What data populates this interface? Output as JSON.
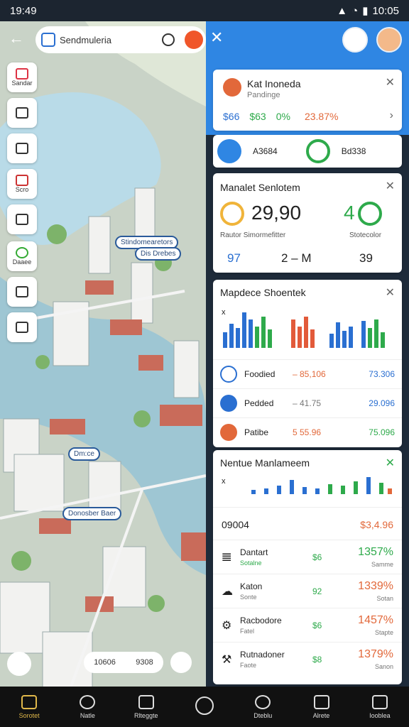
{
  "status": {
    "time": "19:49",
    "clock": "10:05"
  },
  "search": {
    "text": "Sendmuleria"
  },
  "sidebar": [
    {
      "label": "Sandar"
    },
    {
      "label": ""
    },
    {
      "label": ""
    },
    {
      "label": "Scro"
    },
    {
      "label": ""
    },
    {
      "label": "Daaee"
    },
    {
      "label": ""
    },
    {
      "label": ""
    }
  ],
  "map_labels": {
    "a": "Stindomearetors",
    "b": "Dis Drebes",
    "c": "Donosber Baer",
    "d": "Dm:ce"
  },
  "map_bottom": {
    "left": "10606",
    "right": "9308"
  },
  "panel1": {
    "title": "Kat Inoneda",
    "subtitle": "Pandinge",
    "v1": "$66",
    "v2": "$63",
    "v3": "0%",
    "v4": "23.87%",
    "row_left": "A3684",
    "row_right": "Bd338"
  },
  "panel2": {
    "title": "Manalet Senlotem",
    "big": "29,90",
    "big_right": "4",
    "caption_left": "Rautor Simormefitter",
    "caption_right": "Stotecolor",
    "n1": "97",
    "n2": "2 – M",
    "n3": "39"
  },
  "panel3": {
    "title": "Mapdece Shoentek",
    "axis": "x",
    "rows": [
      {
        "name": "Foodied",
        "v1": "– 85,106",
        "v2": "73.306"
      },
      {
        "name": "Pedded",
        "v1": "– 41.75",
        "v2": "29.096"
      },
      {
        "name": "Patibe",
        "v1": "5 55.96",
        "v2": "75.096"
      }
    ]
  },
  "panel4": {
    "title": "Nentue Manlameem",
    "axis": "x",
    "head_left": "09004",
    "head_right": "$3,4.96",
    "rows": [
      {
        "name": "Dantart",
        "sub": "Sotalne",
        "mid": "$6",
        "pct": "1357%",
        "tag": "Samme"
      },
      {
        "name": "Katon",
        "sub": "Sonte",
        "mid": "92",
        "pct": "1339%",
        "tag": "Sotan"
      },
      {
        "name": "Racbodore",
        "sub": "Fatel",
        "mid": "$6",
        "pct": "1457%",
        "tag": "Stapte"
      },
      {
        "name": "Rutnadoner",
        "sub": "Faote",
        "mid": "$8",
        "pct": "1379%",
        "tag": "Sanon"
      }
    ]
  },
  "nav": [
    {
      "label": "Sorotet"
    },
    {
      "label": "Natle"
    },
    {
      "label": "Rlteggte"
    },
    {
      "label": ""
    },
    {
      "label": "Dteblu"
    },
    {
      "label": "Alrete"
    },
    {
      "label": "Iooblea"
    }
  ],
  "colors": {
    "accent": "#2f86e3",
    "green": "#2eaa4b",
    "orange": "#e2683a",
    "blue": "#2a6fd1"
  }
}
